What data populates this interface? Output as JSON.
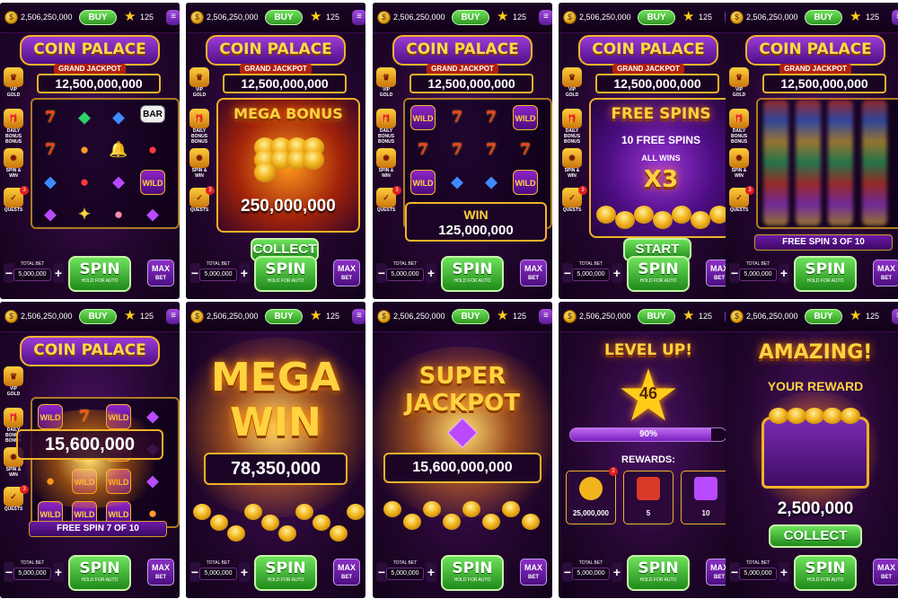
{
  "topbar": {
    "coins": "2,506,250,000",
    "buy_label": "BUY",
    "level": "125",
    "coin_icon": "coin-icon",
    "star_icon": "star-icon",
    "menu_icon": "menu-icon"
  },
  "header": {
    "title": "COIN PALACE",
    "grand_jackpot_label": "GRAND JACKPOT",
    "grand_jackpot_value": "12,500,000,000"
  },
  "sidebar": {
    "vip": "VIP",
    "gold": "GOLD",
    "daily": "DAILY BONUS",
    "bonus": "BONUS",
    "spin_win": "SPIN & WIN",
    "quests": "QUESTS",
    "quests_badge": "3"
  },
  "bottom": {
    "total_bet_label": "TOTAL BET",
    "total_bet": "5,000,000",
    "spin": "SPIN",
    "spin_sub": "HOLD FOR AUTO",
    "max": "MAX",
    "bet": "BET",
    "minus": "−",
    "plus": "+"
  },
  "reel_symbols": {
    "seven": "7",
    "bar": "BAR",
    "wild": "WILD"
  },
  "mega_bonus": {
    "title": "MEGA BONUS",
    "amount": "250,000,000",
    "collect": "COLLECT"
  },
  "win": {
    "label": "WIN",
    "amount": "125,000,000"
  },
  "free_spins": {
    "title": "FREE SPINS",
    "count": "10 FREE SPINS",
    "all_wins": "ALL WINS",
    "mult": "X3",
    "start": "START"
  },
  "free_spin_progress": {
    "label": "FREE SPIN 3 OF 10"
  },
  "free_spin_win": {
    "amount": "15,600,000",
    "label": "FREE SPIN 7 OF 10"
  },
  "mega_win": {
    "line1": "MEGA",
    "line2": "WIN",
    "amount": "78,350,000"
  },
  "super_jackpot": {
    "line1": "SUPER",
    "line2": "JACKPOT",
    "amount": "15,600,000,000"
  },
  "level_up": {
    "title": "LEVEL UP!",
    "level": "46",
    "progress": "90%",
    "progress_fraction": 0.9,
    "rewards_label": "REWARDS:",
    "reward1": "25,000,000",
    "reward1_badge": "2",
    "reward2": "5",
    "reward3": "10"
  },
  "amazing": {
    "title": "AMAZING!",
    "subtitle": "YOUR REWARD",
    "amount": "2,500,000",
    "collect": "COLLECT"
  }
}
